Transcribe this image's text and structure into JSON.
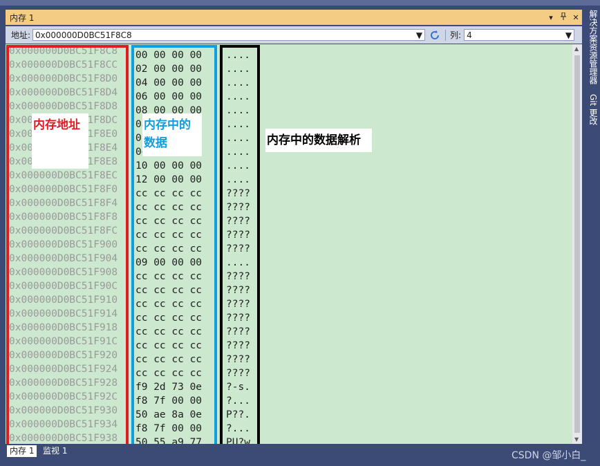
{
  "window": {
    "title": "内存 1",
    "dropdown_icon": "▾",
    "pin_icon": "📌",
    "close_icon": "✕"
  },
  "toolbar": {
    "address_label": "地址:",
    "address_value": "0x000000D0BC51F8C8",
    "column_label": "列:",
    "column_value": "4"
  },
  "rows": [
    {
      "addr": "0x000000D0BC51F8C8",
      "bytes": "00 00 00 00",
      "ascii": "...."
    },
    {
      "addr": "0x000000D0BC51F8CC",
      "bytes": "02 00 00 00",
      "ascii": "...."
    },
    {
      "addr": "0x000000D0BC51F8D0",
      "bytes": "04 00 00 00",
      "ascii": "...."
    },
    {
      "addr": "0x000000D0BC51F8D4",
      "bytes": "06 00 00 00",
      "ascii": "...."
    },
    {
      "addr": "0x000000D0BC51F8D8",
      "bytes": "08 00 00 00",
      "ascii": "...."
    },
    {
      "addr": "0x000000D0BC51F8DC",
      "bytes": "0a 00 00 00",
      "ascii": "...."
    },
    {
      "addr": "0x000000D0BC51F8E0",
      "bytes": "0c 00 00 00",
      "ascii": "...."
    },
    {
      "addr": "0x000000D0BC51F8E4",
      "bytes": "0e 00 00 00",
      "ascii": "...."
    },
    {
      "addr": "0x000000D0BC51F8E8",
      "bytes": "10 00 00 00",
      "ascii": "...."
    },
    {
      "addr": "0x000000D0BC51F8EC",
      "bytes": "12 00 00 00",
      "ascii": "...."
    },
    {
      "addr": "0x000000D0BC51F8F0",
      "bytes": "cc cc cc cc",
      "ascii": "????"
    },
    {
      "addr": "0x000000D0BC51F8F4",
      "bytes": "cc cc cc cc",
      "ascii": "????"
    },
    {
      "addr": "0x000000D0BC51F8F8",
      "bytes": "cc cc cc cc",
      "ascii": "????"
    },
    {
      "addr": "0x000000D0BC51F8FC",
      "bytes": "cc cc cc cc",
      "ascii": "????"
    },
    {
      "addr": "0x000000D0BC51F900",
      "bytes": "cc cc cc cc",
      "ascii": "????"
    },
    {
      "addr": "0x000000D0BC51F904",
      "bytes": "09 00 00 00",
      "ascii": "...."
    },
    {
      "addr": "0x000000D0BC51F908",
      "bytes": "cc cc cc cc",
      "ascii": "????"
    },
    {
      "addr": "0x000000D0BC51F90C",
      "bytes": "cc cc cc cc",
      "ascii": "????"
    },
    {
      "addr": "0x000000D0BC51F910",
      "bytes": "cc cc cc cc",
      "ascii": "????"
    },
    {
      "addr": "0x000000D0BC51F914",
      "bytes": "cc cc cc cc",
      "ascii": "????"
    },
    {
      "addr": "0x000000D0BC51F918",
      "bytes": "cc cc cc cc",
      "ascii": "????"
    },
    {
      "addr": "0x000000D0BC51F91C",
      "bytes": "cc cc cc cc",
      "ascii": "????"
    },
    {
      "addr": "0x000000D0BC51F920",
      "bytes": "cc cc cc cc",
      "ascii": "????"
    },
    {
      "addr": "0x000000D0BC51F924",
      "bytes": "cc cc cc cc",
      "ascii": "????"
    },
    {
      "addr": "0x000000D0BC51F928",
      "bytes": "f9 2d 73 0e",
      "ascii": "?-s."
    },
    {
      "addr": "0x000000D0BC51F92C",
      "bytes": "f8 7f 00 00",
      "ascii": "?..."
    },
    {
      "addr": "0x000000D0BC51F930",
      "bytes": "50 ae 8a 0e",
      "ascii": "P??."
    },
    {
      "addr": "0x000000D0BC51F934",
      "bytes": "f8 7f 00 00",
      "ascii": "?..."
    },
    {
      "addr": "0x000000D0BC51F938",
      "bytes": "50 55 a9 77",
      "ascii": "PU?w"
    }
  ],
  "annotations": {
    "addr_label": "内存地址",
    "data_label_1": "内存中的",
    "data_label_2": "数据",
    "parse_label": "内存中的数据解析"
  },
  "tabs": {
    "memory": "内存 1",
    "watch": "监视 1"
  },
  "watermark": "CSDN @邹小白_",
  "right_panel": {
    "solution": "解决方案资源管理器",
    "git": "Git 更改"
  }
}
